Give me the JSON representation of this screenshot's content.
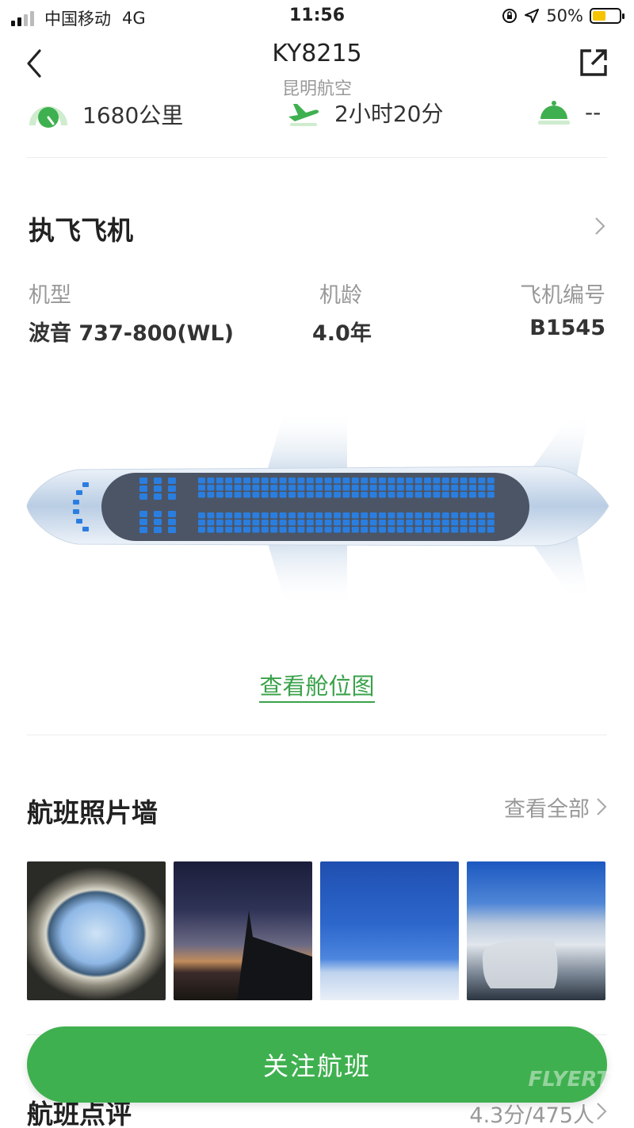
{
  "status_bar": {
    "carrier": "中国移动",
    "network": "4G",
    "time": "11:56",
    "battery_percent": "50%",
    "battery_level": 0.5,
    "battery_color": "#f5c400"
  },
  "header": {
    "flight_number": "KY8215",
    "airline": "昆明航空"
  },
  "stats": {
    "distance": "1680公里",
    "duration": "2小时20分",
    "meal": "--"
  },
  "aircraft": {
    "section_title": "执飞飞机",
    "model_label": "机型",
    "model_value": "波音 737-800(WL)",
    "age_label": "机龄",
    "age_value": "4.0年",
    "reg_label": "飞机编号",
    "reg_value": "B1545",
    "seat_map_link": "查看舱位图"
  },
  "photos": {
    "section_title": "航班照片墙",
    "view_all": "查看全部",
    "items": [
      {
        "name": "window-view"
      },
      {
        "name": "sunset-wing"
      },
      {
        "name": "blue-sky-clouds"
      },
      {
        "name": "engine-clouds"
      }
    ]
  },
  "follow_button": "关注航班",
  "review": {
    "title": "航班点评",
    "score": "4.3分/475人"
  },
  "watermark": "FLYERT",
  "colors": {
    "accent_green": "#3fb04f",
    "link_green": "#3aa24a",
    "seat_blue": "#2a7ee0"
  },
  "icons": [
    "back-arrow-icon",
    "share-icon",
    "speedometer-icon",
    "plane-takeoff-icon",
    "meal-cloche-icon",
    "chevron-right-icon"
  ]
}
